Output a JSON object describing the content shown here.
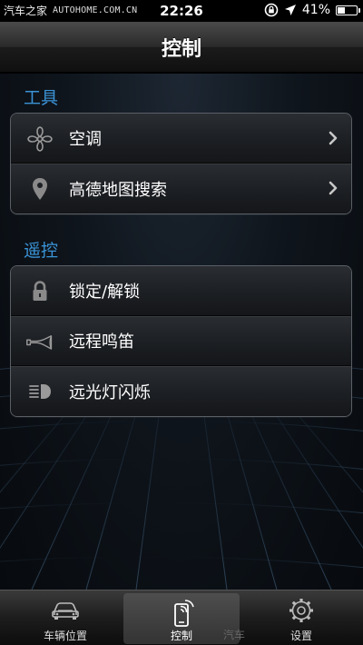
{
  "status_bar": {
    "watermark": "AUTOHOME.COM.CN",
    "carrier": "汽车之家",
    "time": "22:26",
    "battery": "41%",
    "battery_level": 0.41
  },
  "nav": {
    "title": "控制"
  },
  "sections": [
    {
      "title": "工具",
      "items": [
        {
          "label": "空调",
          "icon": "fan-icon",
          "has_chevron": true
        },
        {
          "label": "高德地图搜索",
          "icon": "map-pin-icon",
          "has_chevron": true
        }
      ]
    },
    {
      "title": "遥控",
      "items": [
        {
          "label": "锁定/解锁",
          "icon": "lock-icon"
        },
        {
          "label": "远程鸣笛",
          "icon": "horn-icon"
        },
        {
          "label": "远光灯闪烁",
          "icon": "headlight-icon"
        }
      ]
    }
  ],
  "tabbar": {
    "tabs": [
      {
        "label": "车辆位置",
        "icon": "car-icon",
        "active": false
      },
      {
        "label": "控制",
        "icon": "remote-phone-icon",
        "active": true
      },
      {
        "label": "设置",
        "icon": "gear-icon",
        "active": false
      }
    ],
    "ghost_label": "汽车"
  },
  "colors": {
    "section_title": "#3a93d6",
    "background": "#0b1016"
  }
}
